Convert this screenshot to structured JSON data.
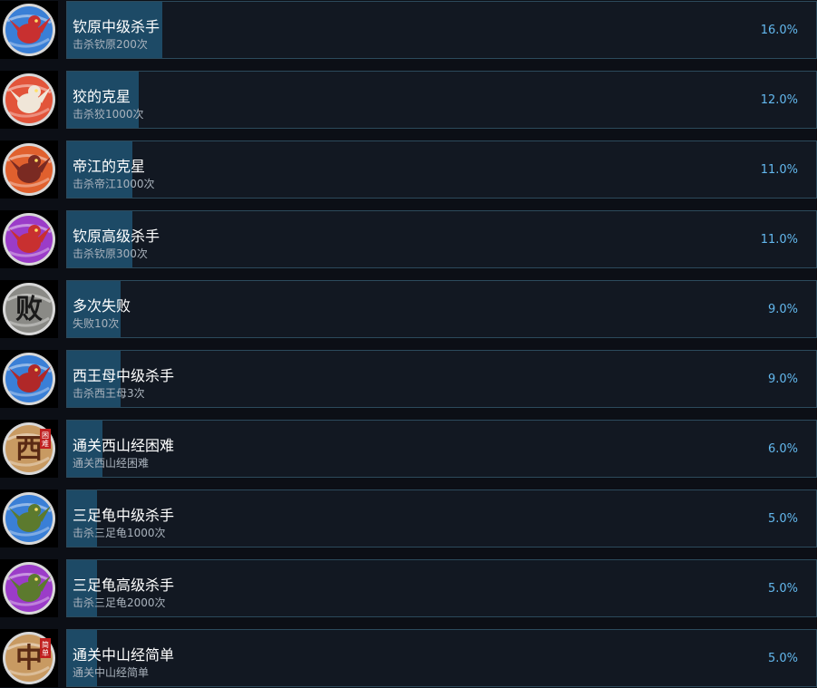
{
  "colors": {
    "background": "#0c0f16",
    "panel": "#121822",
    "panel_border": "#2c4a5c",
    "progress_fill": "#1d4a66",
    "title_text": "#ffffff",
    "desc_text": "#aab3bd",
    "percent_text": "#63b8ee"
  },
  "achievements": [
    {
      "title": "钦原中级杀手",
      "description": "击杀钦原200次",
      "percent_label": "16.0%",
      "percent": 16.0,
      "icon": "bird-monster-icon",
      "icon_bg": "#3a7fd6",
      "icon_accent": "#c83030"
    },
    {
      "title": "狡的克星",
      "description": "击杀狡1000次",
      "percent_label": "12.0%",
      "percent": 12.0,
      "icon": "wolf-monster-icon",
      "icon_bg": "#e2543a",
      "icon_accent": "#f0e6d8"
    },
    {
      "title": "帝江的克星",
      "description": "击杀帝江1000次",
      "percent_label": "11.0%",
      "percent": 11.0,
      "icon": "dijiang-monster-icon",
      "icon_bg": "#e0602e",
      "icon_accent": "#7a2a22"
    },
    {
      "title": "钦原高级杀手",
      "description": "击杀钦原300次",
      "percent_label": "11.0%",
      "percent": 11.0,
      "icon": "bird-monster-icon",
      "icon_bg": "#9b3cc8",
      "icon_accent": "#c83030"
    },
    {
      "title": "多次失败",
      "description": "失败10次",
      "percent_label": "9.0%",
      "percent": 9.0,
      "icon": "defeat-glyph-icon",
      "icon_bg": "#8a8a86",
      "icon_accent": "#1a1a1a",
      "icon_glyph": "败"
    },
    {
      "title": "西王母中级杀手",
      "description": "击杀西王母3次",
      "percent_label": "9.0%",
      "percent": 9.0,
      "icon": "xiwangmu-monster-icon",
      "icon_bg": "#3a7fd6",
      "icon_accent": "#b02828"
    },
    {
      "title": "通关西山经困难",
      "description": "通关西山经困难",
      "percent_label": "6.0%",
      "percent": 6.0,
      "icon": "west-scroll-icon",
      "icon_bg": "#c89a62",
      "icon_accent": "#5a2a14",
      "icon_glyph": "西",
      "icon_stamp": "困难"
    },
    {
      "title": "三足龟中级杀手",
      "description": "击杀三足龟1000次",
      "percent_label": "5.0%",
      "percent": 5.0,
      "icon": "turtle-monster-icon",
      "icon_bg": "#3a7fd6",
      "icon_accent": "#5c7a2e"
    },
    {
      "title": "三足龟高级杀手",
      "description": "击杀三足龟2000次",
      "percent_label": "5.0%",
      "percent": 5.0,
      "icon": "turtle-monster-icon",
      "icon_bg": "#9b3cc8",
      "icon_accent": "#5c7a2e"
    },
    {
      "title": "通关中山经简单",
      "description": "通关中山经简单",
      "percent_label": "5.0%",
      "percent": 5.0,
      "icon": "middle-scroll-icon",
      "icon_bg": "#c89a62",
      "icon_accent": "#5a2a14",
      "icon_glyph": "中",
      "icon_stamp": "简单"
    }
  ]
}
